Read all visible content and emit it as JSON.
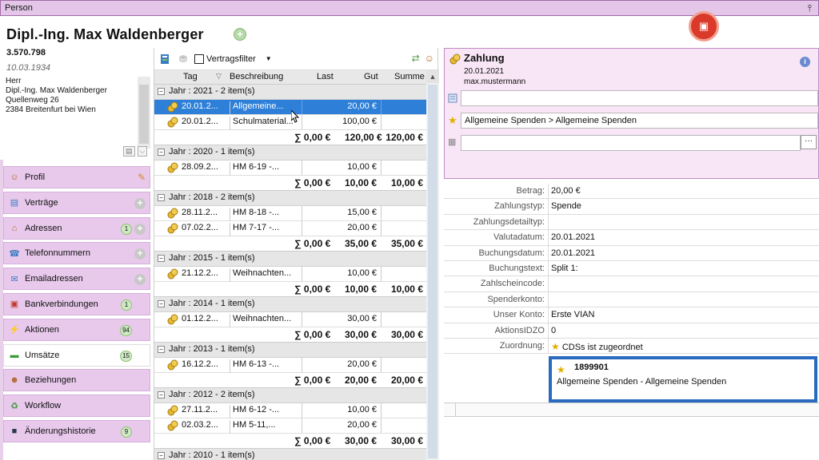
{
  "window": {
    "title": "Person"
  },
  "person": {
    "name": "Dipl.-Ing. Max Waldenberger",
    "id": "3.570.798",
    "dob": "10.03.1934",
    "address_lines": [
      "Herr",
      "Dipl.-Ing. Max Waldenberger",
      "Quellenweg 26",
      "2384 Breitenfurt bei Wien"
    ]
  },
  "nav": {
    "items": [
      {
        "label": "Profil",
        "icon": "person-icon",
        "badge": "",
        "plus": false,
        "edit": true,
        "active": false
      },
      {
        "label": "Verträge",
        "icon": "contract-icon",
        "badge": "",
        "plus": true,
        "edit": false,
        "active": false
      },
      {
        "label": "Adressen",
        "icon": "house-icon",
        "badge": "1",
        "plus": true,
        "edit": false,
        "active": false
      },
      {
        "label": "Telefonnummern",
        "icon": "phone-icon",
        "badge": "",
        "plus": true,
        "edit": false,
        "active": false
      },
      {
        "label": "Emailadressen",
        "icon": "email-icon",
        "badge": "",
        "plus": true,
        "edit": false,
        "active": false
      },
      {
        "label": "Bankverbindungen",
        "icon": "bank-icon",
        "badge": "1",
        "plus": false,
        "edit": false,
        "active": false
      },
      {
        "label": "Aktionen",
        "icon": "lightning-icon",
        "badge": "94",
        "plus": false,
        "edit": false,
        "active": false
      },
      {
        "label": "Umsätze",
        "icon": "money-icon",
        "badge": "15",
        "plus": false,
        "edit": false,
        "active": true
      },
      {
        "label": "Beziehungen",
        "icon": "people-icon",
        "badge": "",
        "plus": false,
        "edit": false,
        "active": false
      },
      {
        "label": "Workflow",
        "icon": "workflow-icon",
        "badge": "",
        "plus": false,
        "edit": false,
        "active": false
      },
      {
        "label": "Änderungshistorie",
        "icon": "history-icon",
        "badge": "9",
        "plus": false,
        "edit": false,
        "active": false
      }
    ]
  },
  "toolbar": {
    "filter_label": "Vertragsfilter"
  },
  "grid": {
    "columns": {
      "tag": "Tag",
      "desc": "Beschreibung",
      "last": "Last",
      "gut": "Gut",
      "summe": "Summe"
    },
    "groups": [
      {
        "label": "Jahr : 2021 - 2 item(s)",
        "rows": [
          {
            "tag": "20.01.2...",
            "desc": "Allgemeine...",
            "gut": "20,00 €",
            "selected": true
          },
          {
            "tag": "20.01.2...",
            "desc": "Schulmaterial...",
            "gut": "100,00 €",
            "selected": false
          }
        ],
        "sum": {
          "last": "∑ 0,00 €",
          "gut": "120,00 €",
          "summe": "120,00 €"
        }
      },
      {
        "label": "Jahr : 2020 - 1 item(s)",
        "rows": [
          {
            "tag": "28.09.2...",
            "desc": "HM 6-19 -...",
            "gut": "10,00 €",
            "selected": false
          }
        ],
        "sum": {
          "last": "∑ 0,00 €",
          "gut": "10,00 €",
          "summe": "10,00 €"
        }
      },
      {
        "label": "Jahr : 2018 - 2 item(s)",
        "rows": [
          {
            "tag": "28.11.2...",
            "desc": "HM 8-18 -...",
            "gut": "15,00 €",
            "selected": false
          },
          {
            "tag": "07.02.2...",
            "desc": "HM 7-17 -...",
            "gut": "20,00 €",
            "selected": false
          }
        ],
        "sum": {
          "last": "∑ 0,00 €",
          "gut": "35,00 €",
          "summe": "35,00 €"
        }
      },
      {
        "label": "Jahr : 2015 - 1 item(s)",
        "rows": [
          {
            "tag": "21.12.2...",
            "desc": "Weihnachten...",
            "gut": "10,00 €",
            "selected": false
          }
        ],
        "sum": {
          "last": "∑ 0,00 €",
          "gut": "10,00 €",
          "summe": "10,00 €"
        }
      },
      {
        "label": "Jahr : 2014 - 1 item(s)",
        "rows": [
          {
            "tag": "01.12.2...",
            "desc": "Weihnachten...",
            "gut": "30,00 €",
            "selected": false
          }
        ],
        "sum": {
          "last": "∑ 0,00 €",
          "gut": "30,00 €",
          "summe": "30,00 €"
        }
      },
      {
        "label": "Jahr : 2013 - 1 item(s)",
        "rows": [
          {
            "tag": "16.12.2...",
            "desc": "HM 6-13 -...",
            "gut": "20,00 €",
            "selected": false
          }
        ],
        "sum": {
          "last": "∑ 0,00 €",
          "gut": "20,00 €",
          "summe": "20,00 €"
        }
      },
      {
        "label": "Jahr : 2012 - 2 item(s)",
        "rows": [
          {
            "tag": "27.11.2...",
            "desc": "HM 6-12 -...",
            "gut": "10,00 €",
            "selected": false
          },
          {
            "tag": "02.03.2...",
            "desc": "HM 5-11,...",
            "gut": "20,00 €",
            "selected": false
          }
        ],
        "sum": {
          "last": "∑ 0,00 €",
          "gut": "30,00 €",
          "summe": "30,00 €"
        }
      },
      {
        "label": "Jahr : 2010 - 1 item(s)",
        "rows": [],
        "sum": null
      }
    ]
  },
  "zahlung": {
    "title": "Zahlung",
    "date": "20.01.2021",
    "user": "max.mustermann",
    "field1": "",
    "category": "Allgemeine Spenden  >  Allgemeine Spenden",
    "field3": ""
  },
  "props": [
    {
      "key": "Betrag:",
      "value": "20,00 €"
    },
    {
      "key": "Zahlungstyp:",
      "value": "Spende"
    },
    {
      "key": "Zahlungsdetailtyp:",
      "value": ""
    },
    {
      "key": "Valutadatum:",
      "value": "20.01.2021"
    },
    {
      "key": "Buchungsdatum:",
      "value": "20.01.2021"
    },
    {
      "key": "Buchungstext:",
      "value": "Split 1:"
    },
    {
      "key": "Zahlscheincode:",
      "value": ""
    },
    {
      "key": "Spenderkonto:",
      "value": ""
    },
    {
      "key": "Unser Konto:",
      "value": "Erste VIAN"
    },
    {
      "key": "AktionsIDZO",
      "value": "0"
    },
    {
      "key": "Zuordnung:",
      "value": "CDSs ist zugeordnet"
    }
  ],
  "zuordnung": {
    "number": "1899901",
    "name": "Allgemeine Spenden - Allgemeine Spenden"
  }
}
